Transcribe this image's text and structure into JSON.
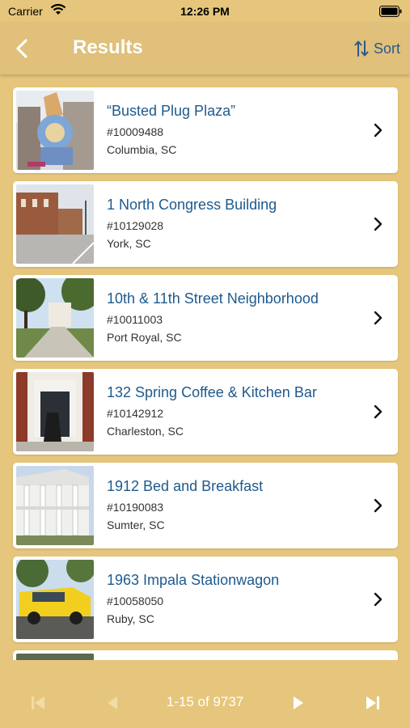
{
  "status_bar": {
    "carrier": "Carrier",
    "time": "12:26 PM",
    "icons": [
      "wifi-icon",
      "battery-icon"
    ]
  },
  "nav": {
    "back_icon": "chevron-left-icon",
    "title": "Results",
    "sort_label": "Sort",
    "sort_icon": "sort-arrows-icon"
  },
  "results": [
    {
      "name": "“Busted Plug Plaza”",
      "ref": "#10009488",
      "location": "Columbia, SC",
      "thumb": "sculpture-photo"
    },
    {
      "name": "1 North Congress Building",
      "ref": "#10129028",
      "location": "York, SC",
      "thumb": "street-building-photo"
    },
    {
      "name": "10th & 11th Street Neighborhood",
      "ref": "#10011003",
      "location": "Port Royal, SC",
      "thumb": "tree-lined-street-photo"
    },
    {
      "name": "132 Spring Coffee & Kitchen Bar",
      "ref": "#10142912",
      "location": "Charleston, SC",
      "thumb": "storefront-photo"
    },
    {
      "name": "1912 Bed and Breakfast",
      "ref": "#10190083",
      "location": "Sumter, SC",
      "thumb": "columned-house-photo"
    },
    {
      "name": "1963 Impala Stationwagon",
      "ref": "#10058050",
      "location": "Ruby, SC",
      "thumb": "yellow-car-photo"
    }
  ],
  "pager": {
    "text": "1-15 of 9737",
    "buttons": [
      "first-page-icon",
      "previous-page-icon",
      "next-page-icon",
      "last-page-icon"
    ]
  },
  "colors": {
    "background": "#e6c67c",
    "title_text": "#ffffff",
    "link_blue": "#1e5a8e"
  }
}
